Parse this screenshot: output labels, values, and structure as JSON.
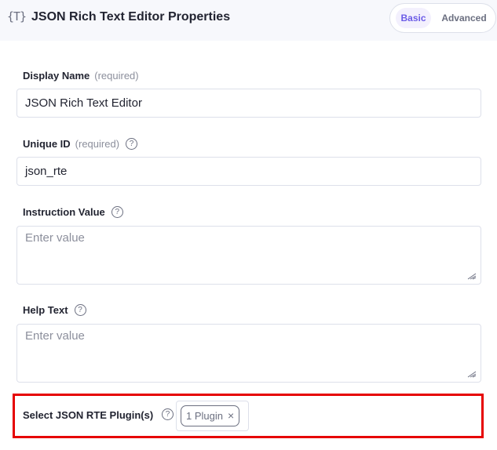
{
  "header": {
    "icon": "{T}",
    "title": "JSON Rich Text Editor Properties",
    "tabs": [
      {
        "label": "Basic",
        "active": true
      },
      {
        "label": "Advanced",
        "active": false
      }
    ]
  },
  "fields": {
    "display_name": {
      "label": "Display Name",
      "required": "(required)",
      "value": "JSON Rich Text Editor"
    },
    "unique_id": {
      "label": "Unique ID",
      "required": "(required)",
      "value": "json_rte"
    },
    "instruction_value": {
      "label": "Instruction Value",
      "placeholder": "Enter value",
      "value": ""
    },
    "help_text": {
      "label": "Help Text",
      "placeholder": "Enter value",
      "value": ""
    },
    "plugins": {
      "label": "Select JSON RTE Plugin(s)",
      "selected": "1 Plugin",
      "remove_glyph": "×"
    }
  },
  "icons": {
    "help": "?"
  },
  "colors": {
    "accent": "#6c5ce7",
    "highlight_border": "#e60000"
  }
}
